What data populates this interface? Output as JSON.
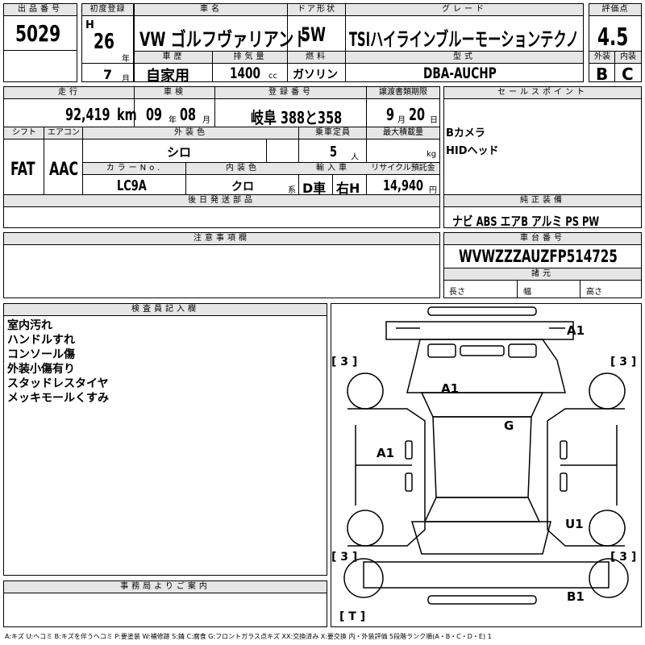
{
  "header": {
    "lot_label": "出品番号",
    "lot": "5029",
    "first_reg_label": "初度登録",
    "era": "H",
    "year_num": "26",
    "year_unit": "年",
    "month_num": "7",
    "month_unit": "月",
    "car_name_label": "車名",
    "car_name": "VW ゴルフヴァリアント",
    "door_label": "ドア形状",
    "door": "5W",
    "grade_label": "グレード",
    "grade": "TSIハイラインブルーモーションテクノ",
    "score_label": "評価点",
    "score": "4.5",
    "exterior_label": "外装",
    "exterior": "B",
    "interior_label": "内装",
    "interior": "C",
    "history_label": "車歴",
    "history": "自家用",
    "displacement_label": "排気量",
    "displacement": "1400",
    "displacement_unit": "cc",
    "fuel_label": "燃料",
    "fuel": "ガソリン",
    "model_label": "型式",
    "model": "DBA-AUCHP"
  },
  "spec": {
    "mileage_label": "走行",
    "mileage": "92,419",
    "mileage_unit": "km",
    "inspection_label": "車検",
    "insp_year": "09",
    "insp_year_unit": "年",
    "insp_month": "08",
    "insp_month_unit": "月",
    "plate_label": "登録番号",
    "plate": "岐阜 388と358",
    "transfer_label": "譲渡書類期限",
    "transfer_month": "9",
    "transfer_month_unit": "月",
    "transfer_day": "20",
    "transfer_day_unit": "日",
    "shift_label": "シフト",
    "shift": "FAT",
    "ac_label": "エアコン",
    "ac": "AAC",
    "ext_color_label": "外装色",
    "ext_color": "シロ",
    "capacity_label": "乗車定員",
    "capacity": "5",
    "capacity_unit": "人",
    "max_load_label": "最大積載量",
    "max_load_unit": "kg",
    "color_no_label": "カラーNo.",
    "color_no": "LC9A",
    "int_color_label": "内装色",
    "int_color": "クロ",
    "int_color_unit": "系",
    "import_label": "輸入車",
    "import_type": "D車",
    "steering": "右H",
    "recycle_label": "リサイクル預託金",
    "recycle": "14,940",
    "recycle_unit": "円",
    "later_parts_label": "後日発送部品"
  },
  "sales": {
    "label": "セールスポイント",
    "points": [
      "Bカメラ",
      "HIDヘッド"
    ],
    "equip_label": "純正装備",
    "equipment": "ナビ ABS エアB アルミ PS PW",
    "chassis_label": "車台番号",
    "chassis": "WVWZZZAUZFP514725",
    "dims_label": "諸元",
    "length_label": "長さ",
    "width_label": "幅",
    "height_label": "高さ"
  },
  "caution": {
    "label": "注意事項欄"
  },
  "inspector": {
    "label": "検査員記入欄",
    "notes": [
      "室内汚れ",
      "ハンドルすれ",
      "コンソール傷",
      "外装小傷有り",
      "スタッドレスタイヤ",
      "メッキモールくすみ"
    ]
  },
  "office": {
    "label": "事務局よりご案内"
  },
  "diagram": {
    "marks": {
      "front_bumper": "A1",
      "hood": "A1",
      "roof": "G",
      "left_door": "A1",
      "right_rear": "U1",
      "rear_bumper": "B1"
    },
    "tires": [
      "[ 3 ]",
      "[ 3 ]",
      "[ 3 ]",
      "[ 3 ]"
    ],
    "spare": "[ T ]"
  },
  "legend": "A:キズ U:ヘコミ B:キズを伴うヘコミ P:要塗装 W:補修跡 S:錆 C:腐食 G:フロントガラス点キズ XX:交換済み X:要交換 内・外装評価 5段階ランク順(A・B・C・D・E) 1"
}
